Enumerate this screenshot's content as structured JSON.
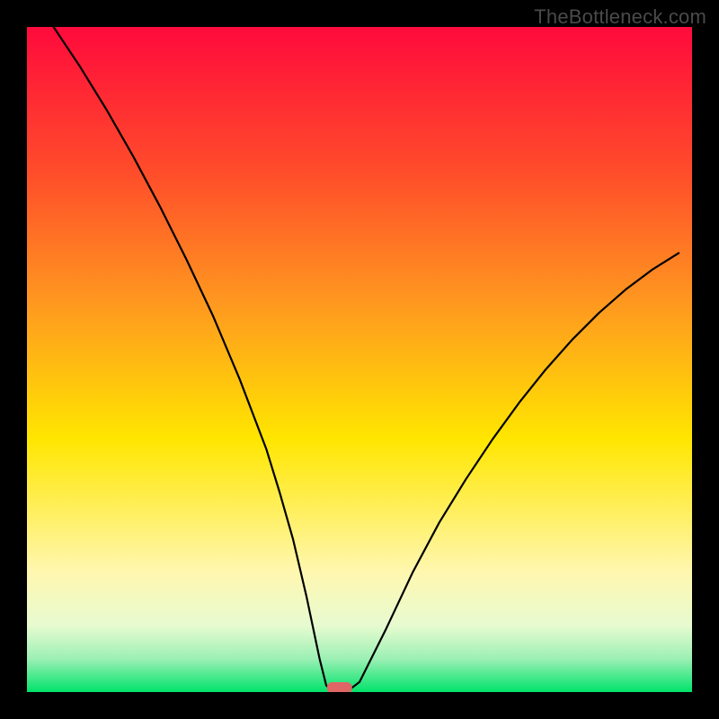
{
  "watermark": "TheBottleneck.com",
  "colors": {
    "frame": "#000000",
    "curve": "#000000",
    "marker": "#e06666",
    "gradient_top": "#ff0a3c",
    "gradient_orange": "#ff7a1f",
    "gradient_yellow": "#ffe600",
    "gradient_cream": "#fff7b0",
    "gradient_pale": "#d8f7c8",
    "gradient_green": "#00e36a"
  },
  "chart_data": {
    "type": "line",
    "title": "",
    "xlabel": "",
    "ylabel": "",
    "xlim": [
      0,
      100
    ],
    "ylim": [
      0,
      100
    ],
    "x": [
      4,
      8,
      12,
      16,
      20,
      24,
      28,
      32,
      36,
      38,
      40,
      42,
      44,
      45,
      46,
      48,
      50,
      54,
      58,
      62,
      66,
      70,
      74,
      78,
      82,
      86,
      90,
      94,
      98
    ],
    "values": [
      100,
      94,
      87.5,
      80.5,
      73,
      65,
      56.5,
      47,
      36.5,
      30,
      23,
      14.5,
      5,
      1,
      0,
      0,
      1.5,
      9.5,
      18,
      25.5,
      32,
      38,
      43.5,
      48.5,
      53,
      57,
      60.5,
      63.5,
      66
    ],
    "minimum_x": 47,
    "minimum_y": 0,
    "notes": "U-shaped bottleneck curve; single minimum near x≈47 marked with a small pink lozenge. Background is a vertical rainbow gradient from red (top) through orange, yellow, pale yellow, pale green to green (bottom)."
  }
}
